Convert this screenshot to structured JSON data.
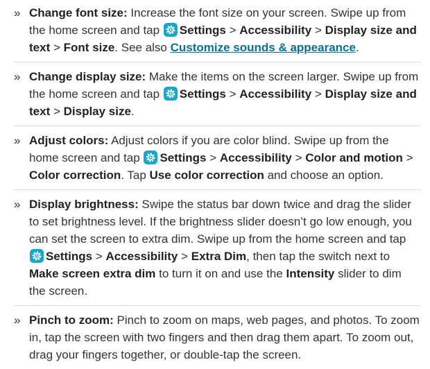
{
  "icons": {
    "settings": "settings-gear-icon"
  },
  "items": [
    {
      "bullet": "»",
      "title": "Change font size:",
      "p1": " Increase the font size on your screen. Swipe up from the home screen and tap ",
      "b1": "Settings",
      "g1": " > ",
      "b2": "Accessibility",
      "g2": " > ",
      "b3": "Display size and text",
      "g3": " > ",
      "b4": "Font size",
      "p2": ". See also ",
      "link": "Customize sounds & appearance",
      "p3": "."
    },
    {
      "bullet": "»",
      "title": "Change display size:",
      "p1": " Make the items on the screen larger. Swipe up from the home screen and tap ",
      "b1": "Settings",
      "g1": " > ",
      "b2": "Accessibility",
      "g2": " > ",
      "b3": "Display size and text",
      "g3": " > ",
      "b4": "Display size",
      "p2": "."
    },
    {
      "bullet": "»",
      "title": "Adjust colors:",
      "p1": " Adjust colors if you are color blind. Swipe up from the home screen and tap ",
      "b1": "Settings",
      "g1": " > ",
      "b2": "Accessibility",
      "g2": " > ",
      "b3": "Color and motion",
      "g3": " > ",
      "b4": "Color correction",
      "p2": ". Tap ",
      "b5": "Use color correction",
      "p3": " and choose an option."
    },
    {
      "bullet": "»",
      "title": "Display brightness:",
      "p1": " Swipe the status bar down twice and drag the slider to set brightness level. If the brightness slider doesn’t go low enough, you can set the screen to extra dim. Swipe up from the home screen and tap ",
      "b1": "Settings",
      "g1": " > ",
      "b2": "Accessibility",
      "g2": " > ",
      "b3": "Extra Dim",
      "p2": ", then tap the switch next to ",
      "b4": "Make screen extra dim",
      "p3": " to turn it on and use the ",
      "b5": "Intensity",
      "p4": " slider to dim the screen."
    },
    {
      "bullet": "»",
      "title": "Pinch to zoom:",
      "p1": " Pinch to zoom on maps, web pages, and photos. To zoom in, tap the screen with two fingers and then drag them apart. To zoom out, drag your fingers together, or double-tap the screen."
    }
  ]
}
